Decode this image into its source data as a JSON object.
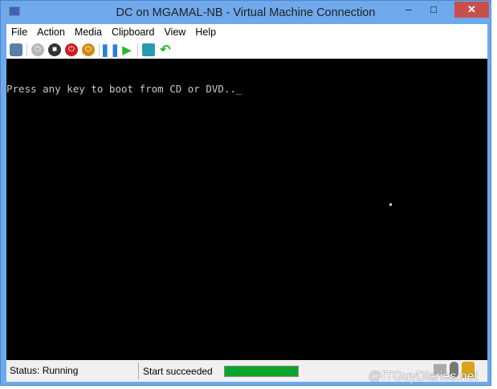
{
  "window": {
    "title": "DC on MGAMAL-NB - Virtual Machine Connection",
    "minimize": "–",
    "maximize": "□",
    "close": "✕"
  },
  "menu": [
    "File",
    "Action",
    "Media",
    "Clipboard",
    "View",
    "Help"
  ],
  "toolbar": [
    {
      "icon": "ctrl-alt-del-icon",
      "color": "#5b7fa6"
    },
    {
      "icon": "start-icon",
      "color": "#b5b5b5"
    },
    {
      "icon": "turn-off-icon",
      "color": "#333333"
    },
    {
      "icon": "shutdown-icon",
      "color": "#c81e1e"
    },
    {
      "icon": "save-icon",
      "color": "#d08a10"
    },
    {
      "icon": "pause-icon",
      "color": "#2a7fd4"
    },
    {
      "icon": "resume-icon",
      "color": "#2fb52f"
    },
    {
      "icon": "snapshot-icon",
      "color": "#2a9bb0"
    },
    {
      "icon": "revert-icon",
      "color": "#2fb52f"
    }
  ],
  "console": {
    "text": "Press any key to boot from CD or DVD.._"
  },
  "status": {
    "state": "Status: Running",
    "message": "Start succeeded",
    "progress_percent": 100,
    "progress_color": "#0aa62c"
  },
  "watermark": "@ITGuyDiaries.net"
}
